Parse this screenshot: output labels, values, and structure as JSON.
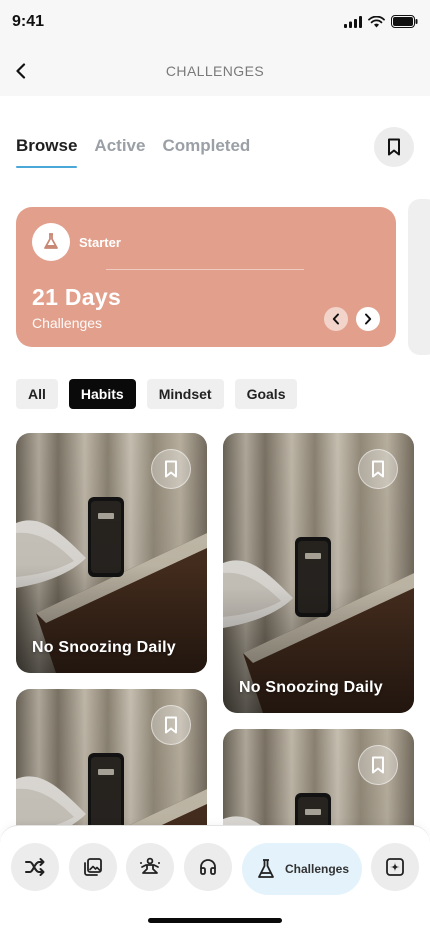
{
  "status_bar": {
    "time": "9:41"
  },
  "nav": {
    "title": "CHALLENGES",
    "back_icon": "chevron-left-icon"
  },
  "tabs": [
    {
      "label": "Browse",
      "active": true
    },
    {
      "label": "Active",
      "active": false
    },
    {
      "label": "Completed",
      "active": false
    }
  ],
  "hero": {
    "label": "Starter",
    "title": "21 Days",
    "subtitle": "Challenges",
    "badge_icon": "flask-icon",
    "color": "#e2a08c"
  },
  "filters": [
    {
      "label": "All",
      "active": false
    },
    {
      "label": "Habits",
      "active": true
    },
    {
      "label": "Mindset",
      "active": false
    },
    {
      "label": "Goals",
      "active": false
    }
  ],
  "cards": [
    {
      "title": "No Snoozing Daily"
    },
    {
      "title": "No Snoozing Daily"
    },
    {
      "title": ""
    },
    {
      "title": ""
    }
  ],
  "bottom_nav": {
    "items": [
      {
        "icon": "shuffle-icon"
      },
      {
        "icon": "gallery-icon"
      },
      {
        "icon": "meditation-icon"
      },
      {
        "icon": "headphones-icon"
      },
      {
        "icon": "flask-icon",
        "label": "Challenges",
        "active": true
      },
      {
        "icon": "sparkle-add-icon"
      }
    ]
  },
  "colors": {
    "accent": "#4aa8d8",
    "active_nav_bg": "#e4f3fb",
    "chip_active": "#0a0a0a"
  }
}
